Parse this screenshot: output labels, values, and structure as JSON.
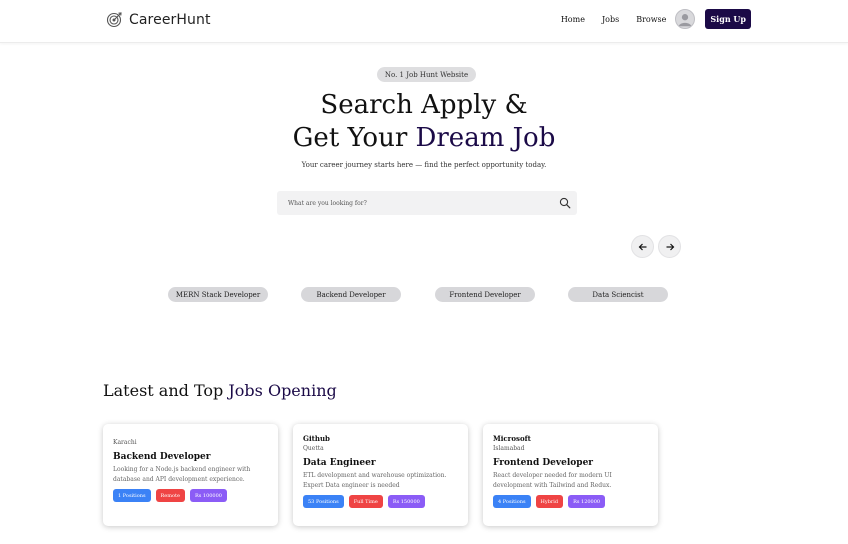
{
  "nav": {
    "brand": "CareerHunt",
    "links": [
      "Home",
      "Jobs",
      "Browse"
    ],
    "signup": "Sign Up"
  },
  "hero": {
    "badge": "No. 1 Job Hunt Website",
    "title_line1": "Search Apply &",
    "title_line2_prefix": "Get Your ",
    "title_line2_accent": "Dream Job",
    "subtitle": "Your career journey starts here — find the perfect opportunity today.",
    "search_placeholder": "What are you looking for?"
  },
  "categories": [
    "MERN Stack Developer",
    "Backend Developer",
    "Frontend Developer",
    "Data Sciencist"
  ],
  "latest": {
    "title_prefix": "Latest and Top ",
    "title_accent": "Jobs Opening",
    "jobs": [
      {
        "company": "",
        "location": "Karachi",
        "title": "Backend Developer",
        "description": "Looking for a Node.js backend engineer with database and API development experience.",
        "positions": "1 Positions",
        "type": "Remote",
        "salary": "Rs 100000"
      },
      {
        "company": "Github",
        "location": "Quetta",
        "title": "Data Engineer",
        "description": "ETL development and warehouse optimization. Expert Data engineer is needed",
        "positions": "53 Positions",
        "type": "Full Time",
        "salary": "Rs 150000"
      },
      {
        "company": "Microsoft",
        "location": "Islamabad",
        "title": "Frontend Developer",
        "description": "React developer needed for modern UI development with Tailwind and Redux.",
        "positions": "4 Positions",
        "type": "Hybrid",
        "salary": "Rs 120000"
      }
    ]
  },
  "colors": {
    "accent": "#1b0a47",
    "badge_blue": "#3b82f6",
    "badge_red": "#ef4444",
    "badge_purple": "#8b5cf6"
  },
  "icons": [
    "target-logo-icon",
    "user-avatar-icon",
    "search-icon",
    "arrow-left-icon",
    "arrow-right-icon"
  ]
}
